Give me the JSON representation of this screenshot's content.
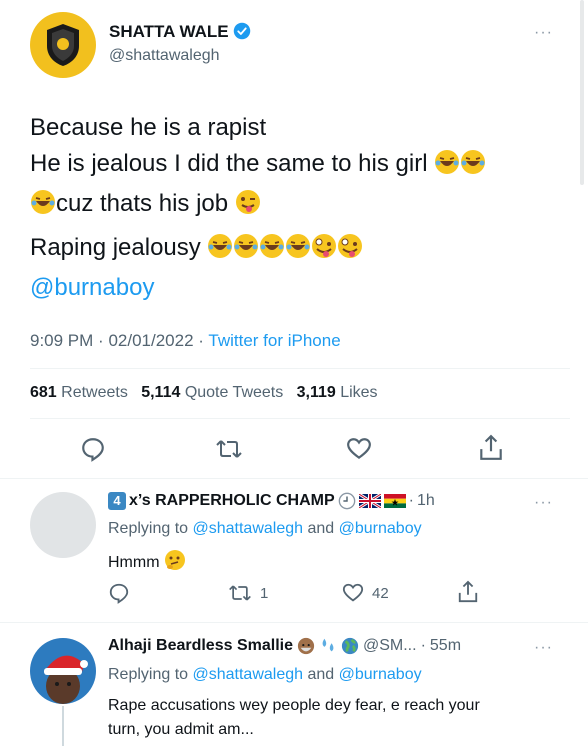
{
  "tweet": {
    "author_name": "SHATTA WALE",
    "author_handle": "@shattawalegh",
    "text_line1": "Because he is a rapist",
    "text_line2": "He is jealous I did the same to his girl",
    "text_line3": "cuz thats his job",
    "text_line4": "Raping jealousy",
    "mention": "@burnaboy",
    "time": "9:09 PM",
    "date": "02/01/2022",
    "source": "Twitter for iPhone",
    "retweets_count": "681",
    "retweets_label": "Retweets",
    "quote_count": "5,114",
    "quote_label": "Quote Tweets",
    "likes_count": "3,119",
    "likes_label": "Likes"
  },
  "replies": [
    {
      "author_name": "x’s RAPPERHOLIC CHAMP",
      "badge_number": "4",
      "time": "1h",
      "replying_prefix": "Replying to",
      "replying_to_1": "@shattawalegh",
      "replying_and": "and",
      "replying_to_2": "@burnaboy",
      "text": "Hmmm",
      "retweet_count": "1",
      "like_count": "42"
    },
    {
      "author_name": "Alhaji Beardless Smallie",
      "handle": "@SM...",
      "time": "55m",
      "replying_prefix": "Replying to",
      "replying_to_1": "@shattawalegh",
      "replying_and": "and",
      "replying_to_2": "@burnaboy",
      "text_line1": "Rape accusations wey people dey fear, e reach your",
      "text_line2": "turn, you admit am..."
    }
  ],
  "dots_label": "···",
  "separator": "·",
  "colors": {
    "link": "#1d9bf0",
    "muted": "#536471",
    "text": "#0f1419",
    "verified": "#1d9bf0"
  },
  "icons": [
    "reply-icon",
    "retweet-icon",
    "like-icon",
    "share-icon",
    "verified-badge-icon",
    "more-icon"
  ]
}
